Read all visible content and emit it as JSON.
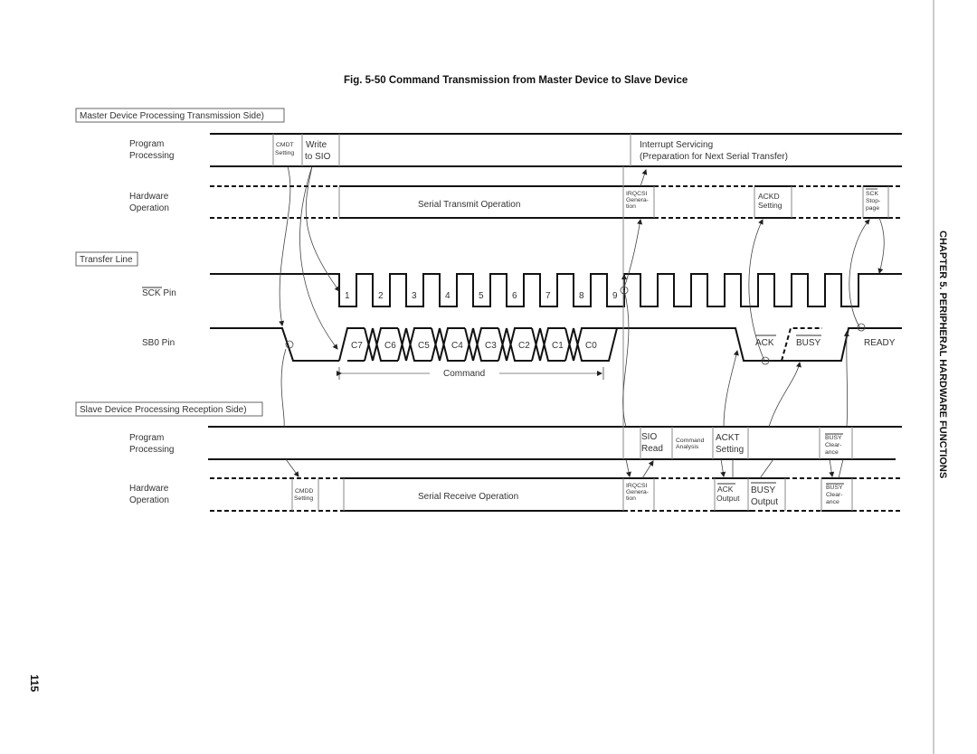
{
  "figure": {
    "title": "Fig. 5-50  Command Transmission from Master Device to Slave Device"
  },
  "sections": {
    "master": "Master Device Processing Transmission Side)",
    "transfer": "Transfer Line",
    "slave": "Slave Device Processing Reception Side)"
  },
  "rows": {
    "program_1": "Program",
    "program_2": "Processing",
    "hardware_1": "Hardware",
    "hardware_2": "Operation",
    "sck_bar": "SCK",
    "sck_rest": " Pin",
    "sb0": "SB0 Pin"
  },
  "master_program": {
    "cmdt_1": "CMDT",
    "cmdt_2": "Setting",
    "write_1": "Write",
    "write_2": "to SIO",
    "interrupt_1": "Interrupt Servicing",
    "interrupt_2": "(Preparation for Next Serial Transfer)"
  },
  "master_hardware": {
    "serial_transmit": "Serial Transmit Operation",
    "irqcsi_1": "IRQCSI",
    "irqcsi_2": "Genera-",
    "irqcsi_3": "tion",
    "ackd_1": "ACKD",
    "ackd_2": "Setting",
    "sck_stop_1": "SCK",
    "sck_stop_2": "Stop-",
    "sck_stop_3": "page"
  },
  "sck_clocks": [
    "1",
    "2",
    "3",
    "4",
    "5",
    "6",
    "7",
    "8",
    "9"
  ],
  "sb0_bits": [
    "C7",
    "C6",
    "C5",
    "C4",
    "C3",
    "C2",
    "C1",
    "C0"
  ],
  "sb0_labels": {
    "ack": "ACK",
    "busy": "BUSY",
    "ready": "READY",
    "command": "Command"
  },
  "slave_program": {
    "sio_1": "SIO",
    "sio_2": "Read",
    "cmd_analysis_1": "Command",
    "cmd_analysis_2": "Analysis",
    "ackt_1": "ACKT",
    "ackt_2": "Setting",
    "busy_clear_1": "BUSY",
    "busy_clear_2": "Clear-",
    "busy_clear_3": "ance"
  },
  "slave_hardware": {
    "cmdd_1": "CMDD",
    "cmdd_2": "Setting",
    "serial_receive": "Serial Receive Operation",
    "irqcsi_1": "IRQCSI",
    "irqcsi_2": "Genera-",
    "irqcsi_3": "tion",
    "ack_out_1": "ACK",
    "ack_out_2": "Output",
    "busy_out_1": "BUSY",
    "busy_out_2": "Output",
    "busy_clear_1": "BUSY",
    "busy_clear_2": "Clear-",
    "busy_clear_3": "ance"
  },
  "page": {
    "chapter": "CHAPTER  5.  PERIPHERAL  HARDWARE  FUNCTIONS",
    "number": "115"
  }
}
